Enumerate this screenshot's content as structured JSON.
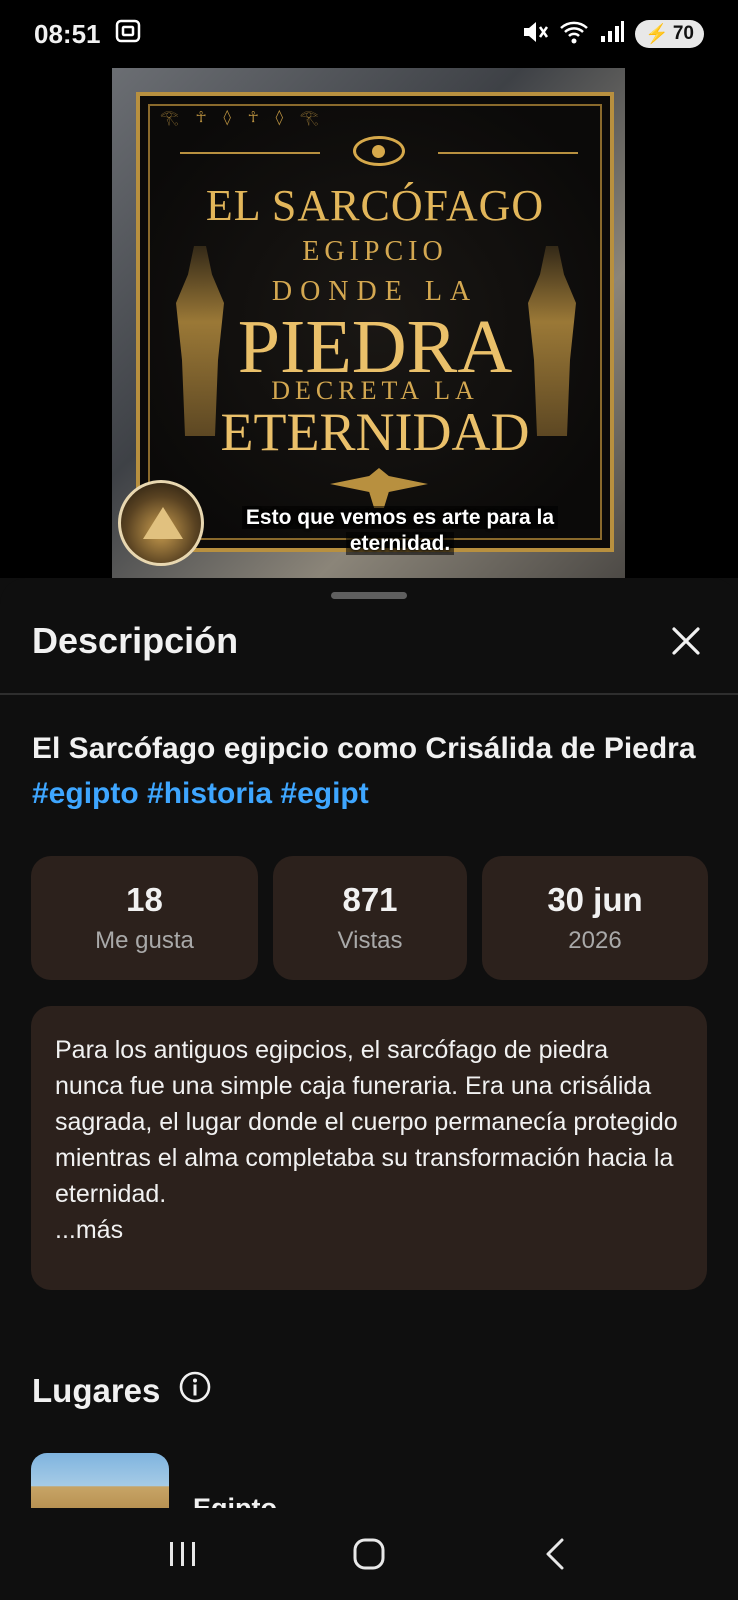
{
  "status_bar": {
    "time": "08:51",
    "battery_level": "70",
    "icons": [
      "screenshot-icon",
      "mute-icon",
      "wifi-icon",
      "signal-icon",
      "battery-charging-icon"
    ]
  },
  "video": {
    "poster_text": {
      "line1": "EL SARCÓFAGO",
      "line2": "EGIPCIO",
      "line3": "DONDE LA",
      "line4": "PIEDRA",
      "line5": "DECRETA LA",
      "line6": "ETERNIDAD"
    },
    "caption_line1": "Esto que vemos es arte para la",
    "caption_line2": "eternidad."
  },
  "sheet": {
    "title": "Descripción",
    "video_title": "El Sarcófago egipcio como Crisálida de Piedra",
    "hashtags": [
      "#egipto",
      "#historia",
      "#egipt"
    ],
    "stats": [
      {
        "value": "18",
        "label": "Me gusta"
      },
      {
        "value": "871",
        "label": "Vistas"
      },
      {
        "value": "30 jun",
        "label": "2026"
      }
    ],
    "description": "Para los antiguos egipcios, el sarcófago de piedra nunca fue una simple caja funeraria. Era una crisálida sagrada, el lugar donde el cuerpo permanecía protegido mientras el alma completaba su transformación hacia la eternidad.",
    "more_label": "...más",
    "places_title": "Lugares",
    "place_name": "Egipto"
  },
  "colors": {
    "background": "#0f0f0f",
    "card": "#2c211c",
    "hashtag": "#3ea6ff",
    "gold": "#d4a851"
  }
}
